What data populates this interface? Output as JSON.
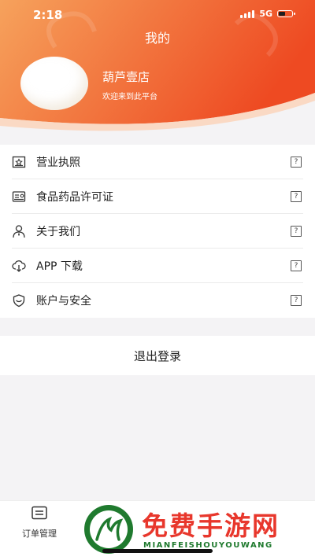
{
  "status_bar": {
    "time": "2:18",
    "network": "5G"
  },
  "header": {
    "title": "我的",
    "store_name": "葫芦壹店",
    "welcome": "欢迎来到此平台",
    "gradient_start": "#f6a15a",
    "gradient_end": "#ee4a22"
  },
  "menu": {
    "items": [
      {
        "label": "营业执照",
        "icon": "license-icon",
        "help": "?"
      },
      {
        "label": "食品药品许可证",
        "icon": "permit-card-icon",
        "help": "?"
      },
      {
        "label": "关于我们",
        "icon": "person-icon",
        "help": "?"
      },
      {
        "label": "APP 下载",
        "icon": "cloud-download-icon",
        "help": "?"
      },
      {
        "label": "账户与安全",
        "icon": "shield-icon",
        "help": "?"
      }
    ]
  },
  "logout_label": "退出登录",
  "tabbar": {
    "tabs": [
      {
        "label": "订单管理",
        "icon": "order-list-icon"
      }
    ]
  },
  "watermark": {
    "title": "免费手游网",
    "subtitle": "MIANFEISHOUYOUWANG",
    "colors": {
      "red": "#e8372c",
      "green": "#1f7a2e"
    }
  }
}
